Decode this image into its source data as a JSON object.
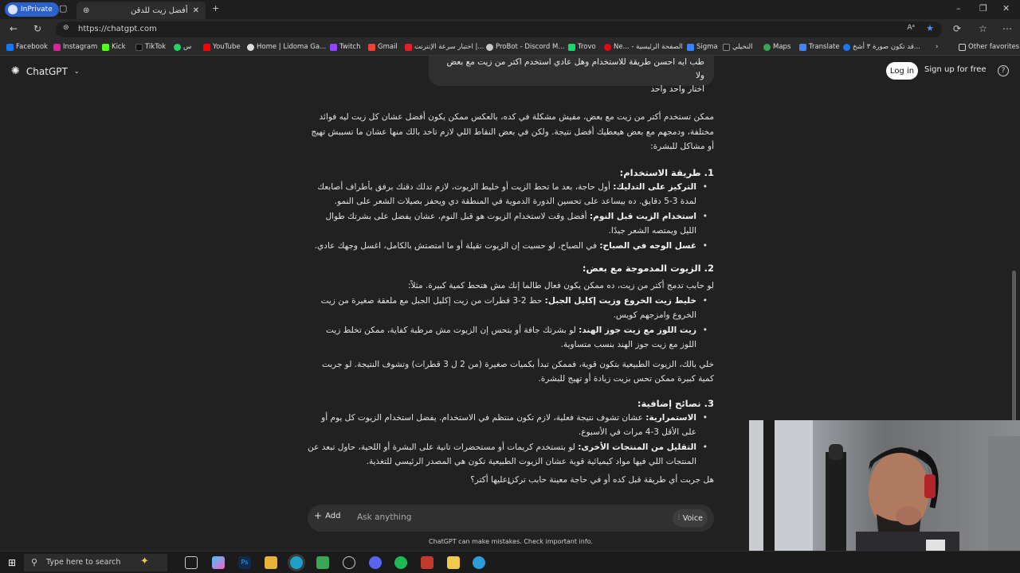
{
  "browser": {
    "inprivate_label": "InPrivate",
    "tab_title": "أفضل زيت للدقن",
    "url": "https://chatgpt.com",
    "bookmarks": [
      "Facebook",
      "Instagram",
      "Kick",
      "TikTok",
      "س",
      "YouTube",
      "Home | Lidoma Ga...",
      "Twitch",
      "Gmail",
      "اختبار سرعة الإنترنت |...",
      "ProBot - Discord M...",
      "Trovo",
      "Ne... - الصفحة الرئيسية",
      "Sigma",
      "النخيلي",
      "Maps",
      "Translate",
      "قد تكون صورة ٣ أشخ...",
      "Other favorites"
    ]
  },
  "header": {
    "brand": "ChatGPT",
    "login": "Log in",
    "signup": "Sign up for free",
    "help_icon": "?"
  },
  "user_message": {
    "line1": "طب ايه احسن طريقة للاستخدام وهل عادي استخدم اكتر من زيت مع بعض ولا",
    "line2": "اختار واحد واحد"
  },
  "answer": {
    "intro": "ممكن تستخدم أكتر من زيت مع بعض، مفيش مشكلة في كده، بالعكس ممكن يكون أفضل عشان كل زيت ليه فوائد مختلفة، ودمجهم مع بعض هيعطيك أفضل نتيجة. ولكن في بعض النقاط اللي لازم تاخد بالك منها عشان ما تسببش تهيج أو مشاكل للبشرة:",
    "s1_title": "1. طريقة الاستخدام:",
    "s1_b1_bold": "التركيز على التدليك:",
    "s1_b1_text": " أول حاجة، بعد ما تحط الزيت أو خليط الزيوت، لازم تدلك دقنك برفق بأطراف أصابعك لمدة 3-5 دقايق. ده بيساعد على تحسين الدورة الدموية في المنطقة دي ويحفز بصيلات الشعر على النمو.",
    "s1_b2_bold": "استخدام الزيت قبل النوم:",
    "s1_b2_text": " أفضل وقت لاستخدام الزيوت هو قبل النوم، عشان يفضل على بشرتك طوال الليل ويمتصه الشعر جيدًا.",
    "s1_b3_bold": "غسل الوجه في الصباح:",
    "s1_b3_text": " في الصباح، لو حسيت إن الزيوت تقيلة أو ما امتصتش بالكامل، اغسل وجهك عادي.",
    "s2_title": "2. الزيوت المدموجة مع بعض:",
    "s2_intro": "لو حابب تدمج أكتر من زيت، ده ممكن يكون فعال طالما إنك مش هتحط كمية كبيرة. مثلاً:",
    "s2_b1_bold": "خليط زيت الخروع وزيت إكليل الجبل:",
    "s2_b1_text": " حط 2-3 قطرات من زيت إكليل الجبل مع ملعقة صغيرة من زيت الخروع وامزجهم كويس.",
    "s2_b2_bold": "زيت اللوز مع زيت جوز الهند:",
    "s2_b2_text": " لو بشرتك جافة أو بتحس إن الزيوت مش مرطبة كفاية، ممكن تخلط زيت اللوز مع زيت جوز الهند بنسب متساوية.",
    "s2_note": "خلي بالك، الزيوت الطبيعية بتكون قوية، فممكن تبدأ بكميات صغيرة (من 2 ل 3 قطرات) وتشوف النتيجة. لو جربت كمية كبيرة ممكن تحس بزيت زيادة أو تهيج للبشرة.",
    "s3_title": "3. نصائح إضافية:",
    "s3_b1_bold": "الاستمرارية:",
    "s3_b1_text": " عشان تشوف نتيجة فعلية، لازم تكون منتظم في الاستخدام. يفضل استخدام الزيوت كل يوم أو على الأقل 3-4 مرات في الأسبوع.",
    "s3_b2_bold": "التقليل من المنتجات الأخرى:",
    "s3_b2_text": " لو بتستخدم كريمات أو مستحضرات تانية على البشرة أو اللحية، حاول تبعد عن المنتجات اللي فيها مواد كيميائية قوية عشان الزيوت الطبيعية تكون هي المصدر الرئيسي للتغذية.",
    "closing": "هل جربت أي طريقة قبل كده أو في حاجة معينة حابب تركز عليها أكتر؟"
  },
  "composer": {
    "add_label": "Add",
    "placeholder": "Ask anything",
    "voice_label": "Voice",
    "disclaimer": "ChatGPT can make mistakes. Check important info."
  },
  "taskbar": {
    "search_placeholder": "Type here to search"
  },
  "colors": {
    "background": "#212121",
    "bubble": "#303030",
    "accent_blue": "#2b61c9"
  }
}
